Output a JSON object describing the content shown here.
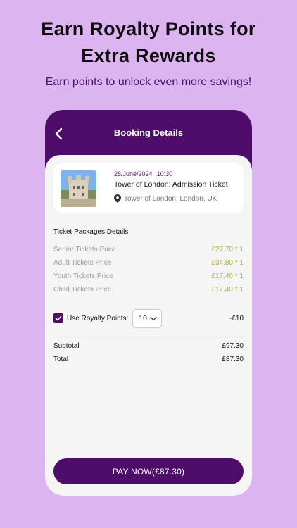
{
  "promo": {
    "headline_line1": "Earn Royalty Points for",
    "headline_line2": "Extra Rewards",
    "subheadline": "Earn points to unlock even more savings!"
  },
  "header": {
    "title": "Booking Details",
    "back_icon": "chevron-left-icon"
  },
  "ticket": {
    "date": "28/June/2024",
    "time": "10:30",
    "name": "Tower of London: Admission Ticket",
    "location": "Tower of London, London, UK",
    "location_icon": "map-pin-icon"
  },
  "packages": {
    "title": "Ticket Packages Details",
    "items": [
      {
        "label": "Senior Tickets Price",
        "price": "£27.70 * 1"
      },
      {
        "label": "Adult Tickets Price",
        "price": "£34.80 * 1"
      },
      {
        "label": "Youth Tickets Price",
        "price": "£17.40 * 1"
      },
      {
        "label": "Child Tickets Price",
        "price": "£17.40 * 1"
      }
    ]
  },
  "royalty": {
    "checked": true,
    "label": "Use Royalty Points:",
    "selected_points": "10",
    "discount": "-£10"
  },
  "totals": {
    "subtotal_label": "Subtotal",
    "subtotal_value": "£97.30",
    "total_label": "Total",
    "total_value": "£87.30"
  },
  "pay_button": {
    "label": "PAY NOW(£87.30)"
  },
  "colors": {
    "background": "#dcb4f0",
    "brand_purple": "#4f0d6b",
    "price_olive": "#b0b04a"
  }
}
